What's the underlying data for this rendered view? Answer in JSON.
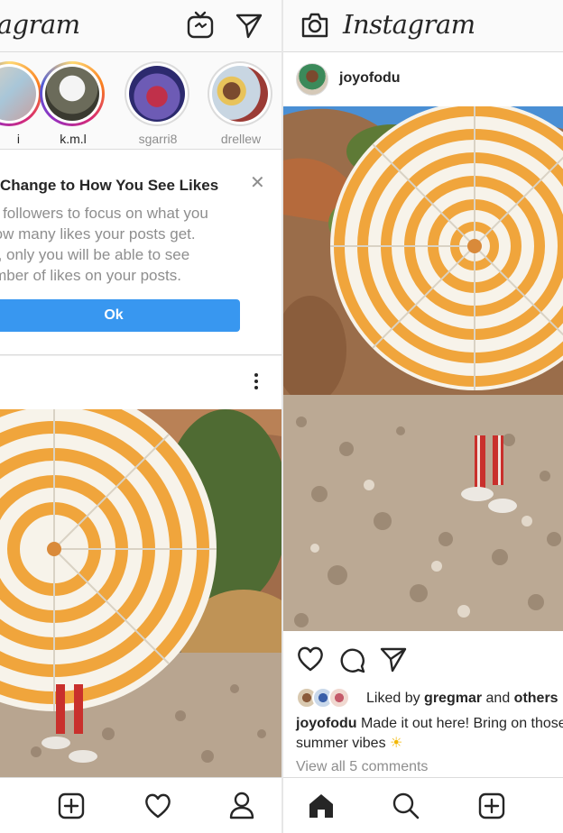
{
  "left": {
    "header": {
      "logo_text": "Instagram",
      "igtv_icon": "igtv-icon",
      "direct_icon": "paper-plane-icon"
    },
    "stories": [
      {
        "name": "i",
        "state": "active"
      },
      {
        "name": "k.m.l",
        "state": "active"
      },
      {
        "name": "sgarri8",
        "state": "seen"
      },
      {
        "name": "drellew",
        "state": "seen"
      }
    ],
    "notice": {
      "title": "Change to How You See Likes",
      "lines": [
        "Your followers to focus on what you",
        "...how many likes your posts get.",
        "...test, only you will be able to see",
        "...number of likes on your posts."
      ],
      "close_icon": "close-icon",
      "ok_label": "Ok"
    },
    "bottom_nav": [
      "add-icon",
      "heart-icon",
      "profile-icon"
    ]
  },
  "right": {
    "header": {
      "logo_text": "Instagram",
      "camera_icon": "camera-icon"
    },
    "post": {
      "username": "joyofodu",
      "liked_by_prefix": "Liked by ",
      "liked_by_user": "gregmar",
      "liked_by_and": " and ",
      "liked_by_others": "others",
      "caption_user": "joyofodu",
      "caption_text_1": " Made it out here! Bring on those",
      "caption_text_2": "summer vibes ",
      "caption_emoji": "☀",
      "view_comments": "View all 5 comments"
    },
    "bottom_nav": [
      "home-icon",
      "search-icon",
      "add-icon"
    ]
  },
  "colors": {
    "accent_blue": "#3897f0",
    "text": "#262626",
    "muted": "#8e8e8e",
    "umbrella_orange": "#f0a53c"
  }
}
